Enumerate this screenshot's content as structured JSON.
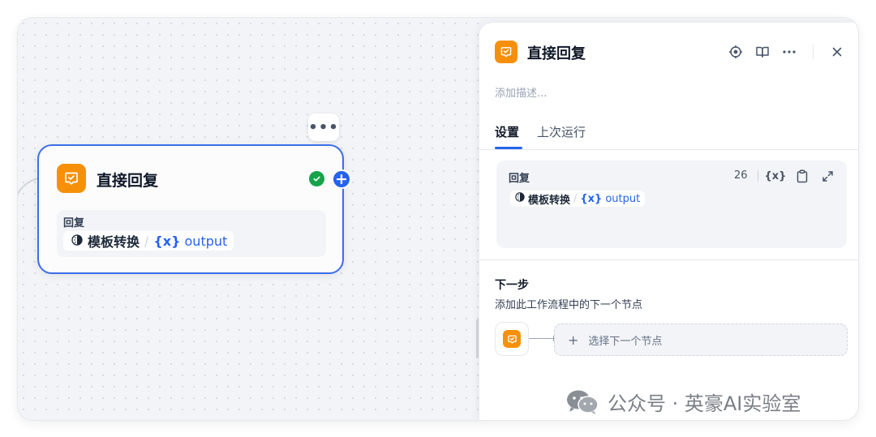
{
  "canvas": {
    "node": {
      "title": "直接回复",
      "reply_label": "回复",
      "var_node": "模板转换",
      "var_sep": "/",
      "var_symbol": "{x}",
      "var_name": "output",
      "more_label": "•••",
      "add_label": "+"
    }
  },
  "panel": {
    "title": "直接回复",
    "description_placeholder": "添加描述...",
    "tabs": [
      {
        "label": "设置",
        "active": true
      },
      {
        "label": "上次运行",
        "active": false
      }
    ],
    "reply": {
      "label": "回复",
      "char_count": "26",
      "var_symbol_tool": "{x}",
      "var_node": "模板转换",
      "var_sep": "/",
      "var_symbol": "{x}",
      "var_name": "output"
    },
    "next_step": {
      "title": "下一步",
      "description": "添加此工作流程中的下一个节点",
      "select_plus": "+",
      "select_label": "选择下一个节点"
    }
  },
  "watermark": {
    "text": "公众号 · 英豪AI实验室"
  },
  "colors": {
    "accent": "#2563eb",
    "node_icon": "#f79009",
    "success": "#16a34a"
  }
}
